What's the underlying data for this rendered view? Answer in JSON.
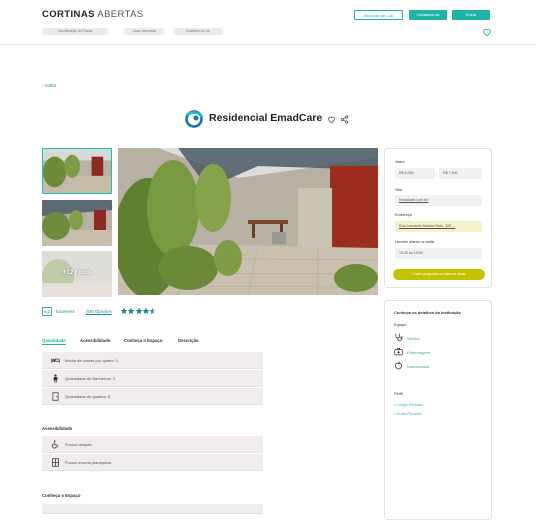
{
  "header": {
    "logo_bold": "CORTINAS",
    "logo_light": "ABERTAS",
    "announce_label": "Anunciar seu Lar",
    "register_label": "Cadastrar-se",
    "login_label": "Entrar",
    "filters": [
      "Identificação do Passar",
      "Casa Informada",
      "Ocasiões do Lar"
    ]
  },
  "back_label": "Voltar",
  "listing": {
    "name": "Residencial EmadCare",
    "more_photos": "+12 Fotos",
    "rating_score": "9,2",
    "rating_label": "Excelente",
    "reviews_label": "(58) Opiniões",
    "stars": 4.5
  },
  "info_card": {
    "value_label": "Valor:",
    "value_min": "R$ 5,000",
    "value_sep": "-",
    "value_max": "R$ 7,500",
    "site_label": "Site:",
    "site_value": "Emadcare.com.br/",
    "address_label": "Endereço",
    "address_value": "Rua Leonardo Martins Neto, 325 ...",
    "hours_label": "Horário aberto a visita",
    "hours_value": "13:30 às 19:00",
    "cta_label": "Fazer pergunta ou Marcar visita"
  },
  "details_card": {
    "title": "Conheça os detalhes da instituição",
    "team_label": "Equipe",
    "team": [
      "Médico",
      "Enfermagem",
      "Nutricionista"
    ],
    "profile_label": "Perfil",
    "profiles": [
      "Longo Período",
      "Curto Período"
    ]
  },
  "tabs": [
    "Quantidade",
    "Acessibilidade",
    "Conheça o Espaço",
    "Descrição"
  ],
  "quantidade": [
    {
      "icon": "bed-icon",
      "text": "Média de camas por quarto: 1"
    },
    {
      "icon": "person-icon",
      "text": "Quantidade de Banheiros: 3"
    },
    {
      "icon": "door-icon",
      "text": "Quantidade de quartos: 5"
    }
  ],
  "acessibilidade_title": "Acessibilidade",
  "acessibilidade": [
    {
      "icon": "wheelchair-icon",
      "text": "Possui rampas"
    },
    {
      "icon": "furniture-icon",
      "text": "Possui moveis planejados"
    }
  ],
  "espaco_title": "Conheça o Espaço",
  "colors": {
    "accent": "#1fb3a6",
    "cta": "#c4c200",
    "star": "#1a8c8c"
  }
}
